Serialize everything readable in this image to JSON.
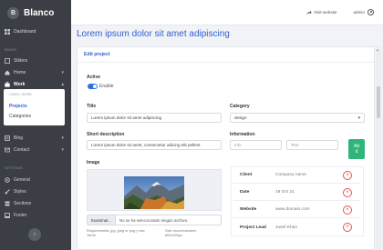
{
  "brand": {
    "badge": "B",
    "name": "Blanco"
  },
  "sidebar": {
    "dashboard": "Dashboard",
    "pages_section": "PAGES",
    "sliders": "Sliders",
    "home": "Home",
    "work": "Work",
    "submenu_header": "CMOS / WORK",
    "projects": "Projects",
    "categories": "Categories",
    "blog": "Blog",
    "contact": "Contact",
    "settings_section": "SETTINGS",
    "general": "General",
    "styles": "Styles",
    "sections": "Sections",
    "footer": "Footer",
    "collapse_glyph": "‹"
  },
  "topbar": {
    "visit_label": "Visit website",
    "user_label": "admin"
  },
  "page": {
    "title": "Lorem ipsum dolor sit amet adipiscing"
  },
  "form": {
    "card_title": "Edit project",
    "active_label": "Active",
    "enable_label": "Enable",
    "title_label": "Title",
    "title_value": "Lorem ipsum dolor sit amet adipiscing",
    "category_label": "Category",
    "category_value": "design",
    "short_desc_label": "Short description",
    "short_desc_value": "Lorem ipsum dolor sit amet, consectetur adicing elit pellent",
    "information_label": "Information",
    "info_placeholder": "Info",
    "text_placeholder": "Text",
    "add_line1": "Ad",
    "add_line2": "d",
    "image_label": "Image",
    "browse_button": "Examinar...",
    "file_status": "No se ha seleccionado ningún archivo.",
    "req_line1": "Requirements: jpg, jpeg or png | max",
    "req_line2": "10mb",
    "size_line1": "Size recommended:",
    "size_line2": "800x450px"
  },
  "info_table": {
    "rows": [
      {
        "key": "Client",
        "value": "Company name"
      },
      {
        "key": "Date",
        "value": "19 Oct 21"
      },
      {
        "key": "Website",
        "value": "www.domain.com"
      },
      {
        "key": "Project Lead",
        "value": "Jusef Khan"
      }
    ],
    "delete_glyph": "×"
  },
  "colors": {
    "accent": "#2f5fd0",
    "sidebar": "#3b3e45",
    "add": "#2fb57a",
    "danger": "#e05555"
  }
}
